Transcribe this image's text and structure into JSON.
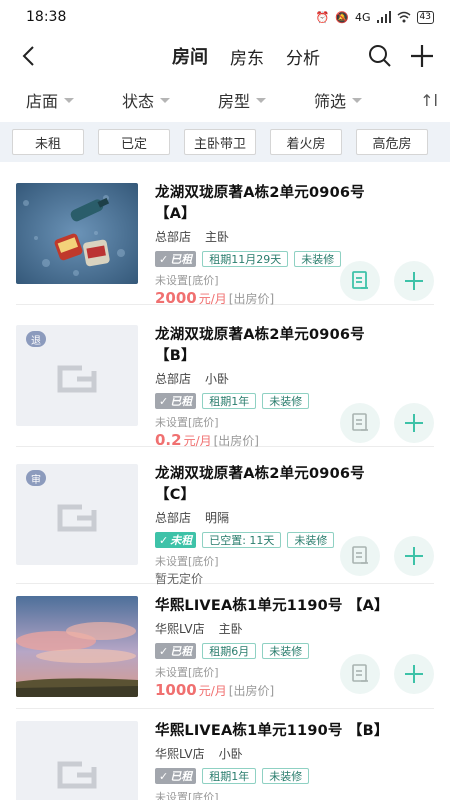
{
  "status_bar": {
    "time": "18:38",
    "network": "4G",
    "battery": "43"
  },
  "nav": {
    "tabs": [
      {
        "label": "房间",
        "active": true
      },
      {
        "label": "房东",
        "active": false
      },
      {
        "label": "分析",
        "active": false
      }
    ]
  },
  "filters": [
    {
      "label": "店面"
    },
    {
      "label": "状态"
    },
    {
      "label": "房型"
    },
    {
      "label": "筛选"
    }
  ],
  "sort_indicator": "↑l",
  "chips": [
    "未租",
    "已定",
    "主卧带卫",
    "着火房",
    "高危房"
  ],
  "colors": {
    "accent": "#3ec2a8",
    "price": "#f07070",
    "rented_tag": "#a2a6ad",
    "chip_bar_bg": "#eef2f7"
  },
  "listings": [
    {
      "title_line1": "龙湖双珑原著A栋2单元0906号",
      "title_line2": "【A】",
      "store": "总部店",
      "room_type": "主卧",
      "status": "已租",
      "tags": [
        "租期11月29天",
        "未装修"
      ],
      "floor_price": "未设置[底价]",
      "price": "2000",
      "price_unit": "元/月",
      "price_note": "[出房价]",
      "image": "photo-bottles"
    },
    {
      "title_line1": "龙湖双珑原著A栋2单元0906号",
      "title_line2": "【B】",
      "store": "总部店",
      "room_type": "小卧",
      "status": "已租",
      "tags": [
        "租期1年",
        "未装修"
      ],
      "floor_price": "未设置[底价]",
      "price": "0.2",
      "price_unit": "元/月",
      "price_note": "[出房价]",
      "badge": "退",
      "image": "placeholder"
    },
    {
      "title_line1": "龙湖双珑原著A栋2单元0906号",
      "title_line2": "【C】",
      "store": "总部店",
      "room_type": "明隔",
      "status": "未租",
      "tags": [
        "已空置: 11天",
        "未装修"
      ],
      "floor_price": "未设置[底价]",
      "no_price": "暂无定价",
      "badge": "审",
      "image": "placeholder"
    },
    {
      "title_line1": "华熙LIVEA栋1单元1190号 【A】",
      "store": "华熙LV店",
      "room_type": "主卧",
      "status": "已租",
      "tags": [
        "租期6月",
        "未装修"
      ],
      "floor_price": "未设置[底价]",
      "price": "1000",
      "price_unit": "元/月",
      "price_note": "[出房价]",
      "image": "photo-sunset"
    },
    {
      "title_line1": "华熙LIVEA栋1单元1190号 【B】",
      "store": "华熙LV店",
      "room_type": "小卧",
      "status": "已租",
      "tags": [
        "租期1年",
        "未装修"
      ],
      "floor_price": "未设置[底价]",
      "image": "placeholder"
    }
  ]
}
